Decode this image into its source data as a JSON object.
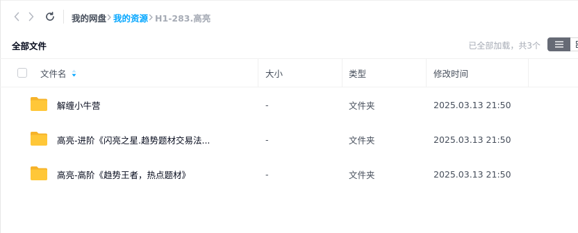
{
  "breadcrumb": {
    "root": "我的网盘",
    "parent": "我的资源",
    "current": "H1-283.高亮"
  },
  "toolbar": {
    "title": "全部文件",
    "loaded_status": "已全部加载，共3个"
  },
  "columns": {
    "name": "文件名",
    "size": "大小",
    "type": "类型",
    "modified": "修改时间"
  },
  "files": [
    {
      "name": "解缠小牛营",
      "size": "-",
      "type": "文件夹",
      "modified": "2025.03.13 21:50",
      "icon": "folder-icon"
    },
    {
      "name": "高亮-进阶《闪亮之星.趋势题材交易法...",
      "size": "-",
      "type": "文件夹",
      "modified": "2025.03.13 21:50",
      "icon": "folder-icon"
    },
    {
      "name": "高亮-高阶《趋势王者，热点题材》",
      "size": "-",
      "type": "文件夹",
      "modified": "2025.03.13 21:50",
      "icon": "folder-icon"
    }
  ],
  "colors": {
    "accent": "#06a7ff",
    "folder": "#ffc738",
    "folder_back": "#f6b32a"
  }
}
